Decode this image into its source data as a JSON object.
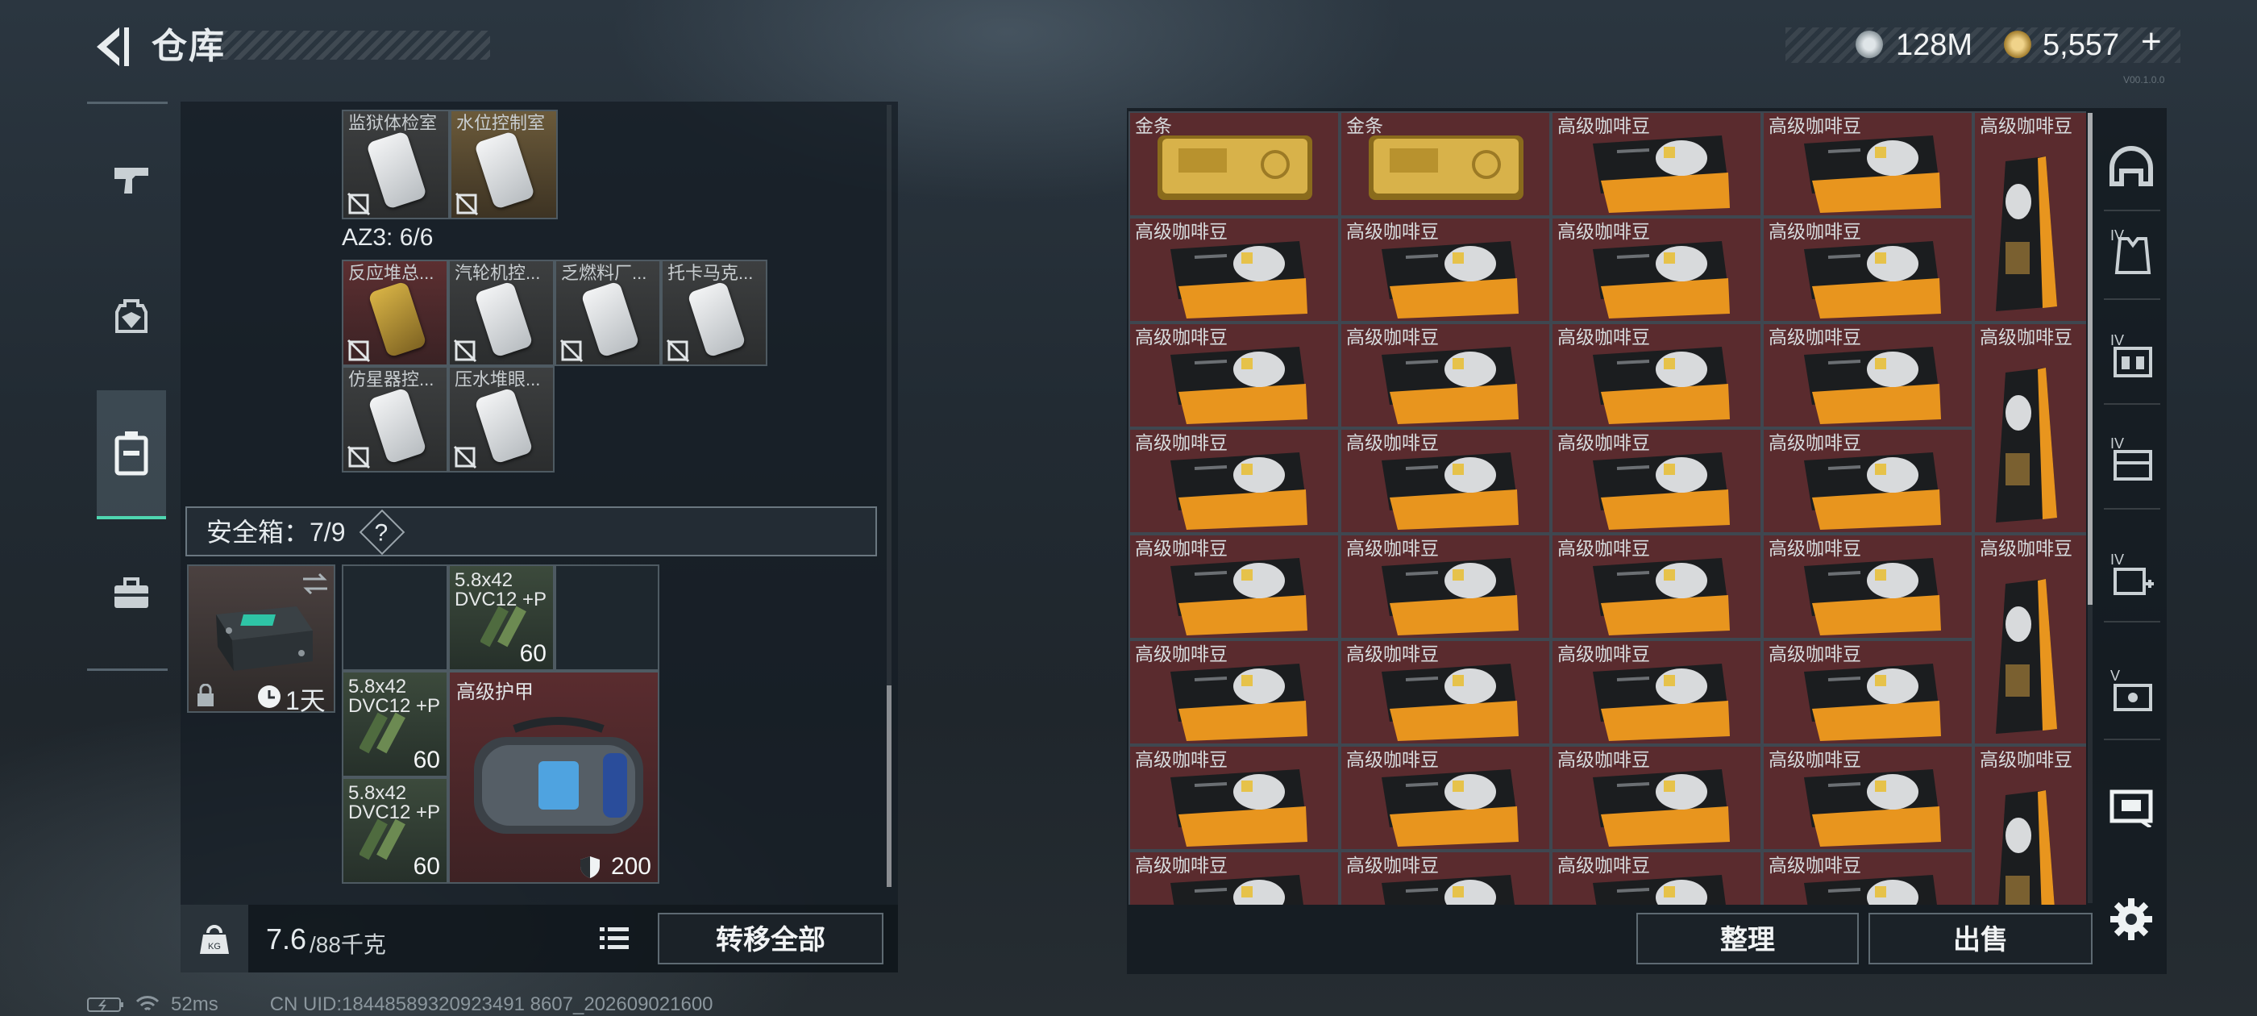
{
  "header": {
    "title": "仓库",
    "currency1": "128M",
    "currency2": "5,557",
    "add_symbol": "+",
    "version": "V00.1.0.0"
  },
  "left_tabs": [
    {
      "name": "weapons",
      "icon": "gun-icon",
      "active": false
    },
    {
      "name": "equipment",
      "icon": "backpack-icon",
      "active": false
    },
    {
      "name": "containers",
      "icon": "container-icon",
      "active": true
    },
    {
      "name": "briefcase",
      "icon": "toolbox-icon",
      "active": false
    }
  ],
  "keycards_top": [
    {
      "label": "监狱体检室"
    },
    {
      "label": "水位控制室"
    }
  ],
  "az3_label": "AZ3: 6/6",
  "keycards_az3": [
    {
      "label": "反应堆总..."
    },
    {
      "label": "汽轮机控..."
    },
    {
      "label": "乏燃料厂..."
    },
    {
      "label": "托卡马克..."
    },
    {
      "label": "仿星器控..."
    },
    {
      "label": "压水堆眼..."
    }
  ],
  "safe_box": {
    "label": "安全箱：7/9",
    "help": "?",
    "timer": "1天",
    "swap_icon": "swap-icon",
    "lock_icon": "lock-icon"
  },
  "safe_items": {
    "ammo": [
      {
        "label": "5.8x42 DVC12 +P",
        "count": "60"
      },
      {
        "label": "5.8x42 DVC12 +P",
        "count": "60"
      },
      {
        "label": "5.8x42 DVC12 +P",
        "count": "60"
      }
    ],
    "armor": {
      "label": "高级护甲",
      "durability": "200"
    }
  },
  "weight": {
    "value": "7.6",
    "max": "/88千克",
    "icon_label": "KG"
  },
  "buttons": {
    "transfer_all": "转移全部",
    "sort": "整理",
    "sell": "出售"
  },
  "stash": {
    "gold_label": "金条",
    "coffee_label": "高级咖啡豆"
  },
  "right_tabs": [
    {
      "label": "",
      "icon": "helmet-icon"
    },
    {
      "label": "IV",
      "icon": "armor-vest-icon"
    },
    {
      "label": "IV",
      "icon": "chest-rig-icon"
    },
    {
      "label": "IV",
      "icon": "backpack-rig-icon"
    },
    {
      "label": "IV",
      "icon": "medkit-icon"
    },
    {
      "label": "V",
      "icon": "safe-case-icon"
    },
    {
      "label": "",
      "icon": "stash-icon"
    }
  ],
  "status_bar": {
    "ping": "52ms",
    "uid": "CN UID:18448589320923491 8607_202609021600"
  }
}
